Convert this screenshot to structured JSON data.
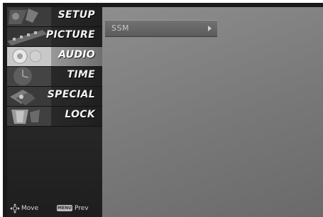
{
  "menu": {
    "items": [
      {
        "label": "SETUP",
        "icon": "setup-icon",
        "active": false
      },
      {
        "label": "PICTURE",
        "icon": "picture-icon",
        "active": false
      },
      {
        "label": "AUDIO",
        "icon": "audio-icon",
        "active": true
      },
      {
        "label": "TIME",
        "icon": "clock-icon",
        "active": false
      },
      {
        "label": "SPECIAL",
        "icon": "special-icon",
        "active": false
      },
      {
        "label": "LOCK",
        "icon": "lock-icon",
        "active": false
      }
    ]
  },
  "submenu": {
    "items": [
      {
        "label": "SSM",
        "icon": "arrow-right-icon"
      }
    ]
  },
  "footer": {
    "move_label": "Move",
    "menu_key_label": "MENU",
    "prev_label": "Prev"
  },
  "colors": {
    "active_highlight": "#b0b0b0",
    "content_bg": "#808080",
    "sidebar_bg": "#2a2a2a"
  }
}
